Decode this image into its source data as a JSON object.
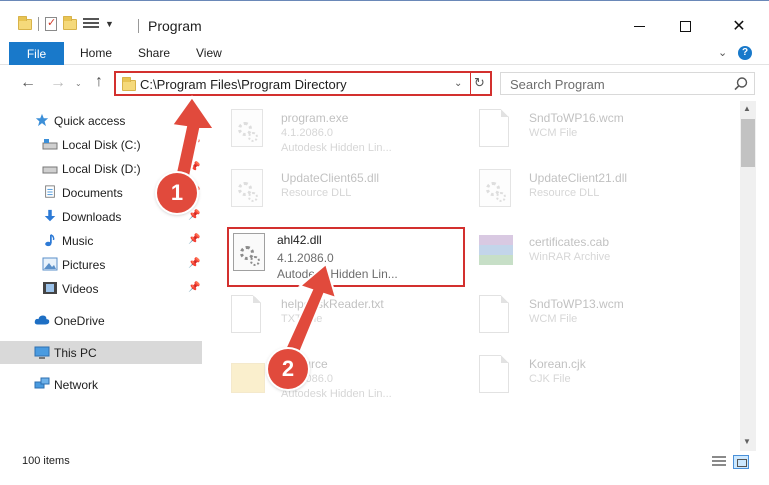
{
  "window": {
    "title": "Program"
  },
  "ribbon": {
    "file": "File",
    "home": "Home",
    "share": "Share",
    "view": "View",
    "help": "?"
  },
  "address": {
    "path": "C:\\Program Files\\Program Directory"
  },
  "search": {
    "placeholder": "Search Program"
  },
  "sidebar": {
    "items": [
      {
        "label": "Quick access"
      },
      {
        "label": "Local Disk (C:)"
      },
      {
        "label": "Local Disk (D:)"
      },
      {
        "label": "Documents"
      },
      {
        "label": "Downloads"
      },
      {
        "label": "Music"
      },
      {
        "label": "Pictures"
      },
      {
        "label": "Videos"
      },
      {
        "label": "OneDrive"
      },
      {
        "label": "This PC"
      },
      {
        "label": "Network"
      }
    ]
  },
  "files": [
    {
      "name": "program.exe",
      "line1": "4.1.2086.0",
      "line2": "Autodesk Hidden Lin..."
    },
    {
      "name": "SndToWP16.wcm",
      "line1": "WCM File",
      "line2": ""
    },
    {
      "name": "UpdateClient65.dll",
      "line1": "Resource DLL",
      "line2": ""
    },
    {
      "name": "UpdateClient21.dll",
      "line1": "Resource DLL",
      "line2": ""
    },
    {
      "name": "ahl42.dll",
      "line1": "4.1.2086.0",
      "line2": "Autodesk Hidden Lin..."
    },
    {
      "name": "certificates.cab",
      "line1": "WinRAR Archive",
      "line2": ""
    },
    {
      "name": "helpdeskReader.txt",
      "line1": "TXT File",
      "line2": ""
    },
    {
      "name": "SndToWP13.wcm",
      "line1": "WCM File",
      "line2": ""
    },
    {
      "name": "resource",
      "line1": "4.1.2086.0",
      "line2": "Autodesk Hidden Lin..."
    },
    {
      "name": "Korean.cjk",
      "line1": "CJK File",
      "line2": ""
    }
  ],
  "status": {
    "items": "100 items"
  },
  "callouts": {
    "one": "1",
    "two": "2"
  },
  "colors": {
    "accent": "#1979ca",
    "highlight": "#d3302e",
    "badge": "#e14a3c",
    "selection": "#cce8ff"
  }
}
